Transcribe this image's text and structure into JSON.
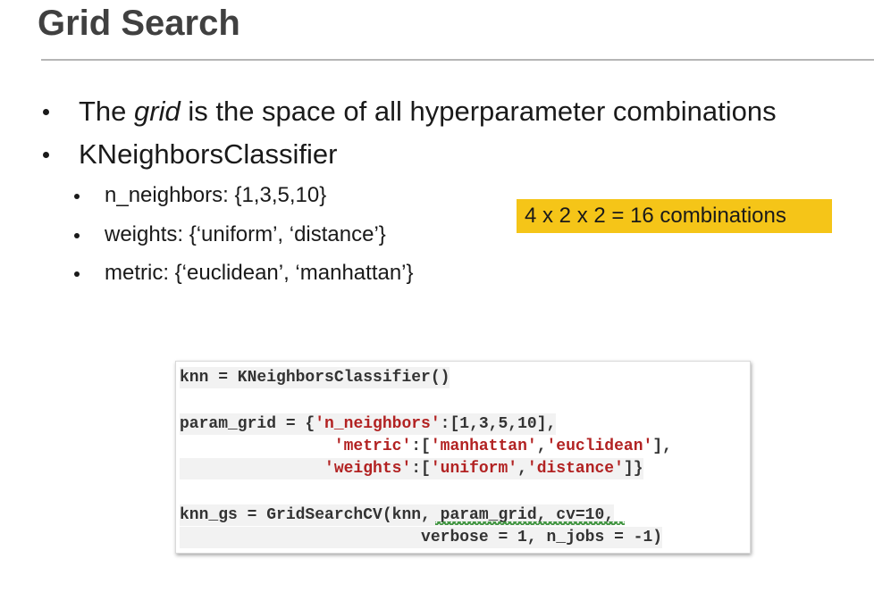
{
  "slide": {
    "title": "Grid Search"
  },
  "bullets": {
    "item1": {
      "before": "The ",
      "emphasis": "grid",
      "after": " is the space of all hyperparameter combinations"
    },
    "item2": "KNeighborsClassifier",
    "sub1": "n_neighbors: {1,3,5,10}",
    "sub2": "weights: {‘uniform’, ‘distance’}",
    "sub3": "metric:  {‘euclidean’, ‘manhattan’}"
  },
  "callout": {
    "text": "4 x 2 x 2 = 16 combinations",
    "color": "#f5c518"
  },
  "code": {
    "l1": "knn = KNeighborsClassifier()",
    "l2": {
      "a": "param_grid = {",
      "s1": "'n_neighbors'",
      "b": ":[1,3,5,10],"
    },
    "l3": {
      "indent": "                ",
      "s1": "'metric'",
      "b": ":[",
      "s2": "'manhattan'",
      "c": ",",
      "s3": "'euclidean'",
      "d": "],"
    },
    "l4": {
      "indent": "               ",
      "s1": "'weights'",
      "b": ":[",
      "s2": "'uniform'",
      "c": ",",
      "s3": "'distance'",
      "d": "]}"
    },
    "l5": "knn_gs = GridSearchCV(knn, param_grid, cv=10,",
    "l6": "                         verbose = 1, n_jobs = -1)",
    "string_color": "#b22222"
  }
}
